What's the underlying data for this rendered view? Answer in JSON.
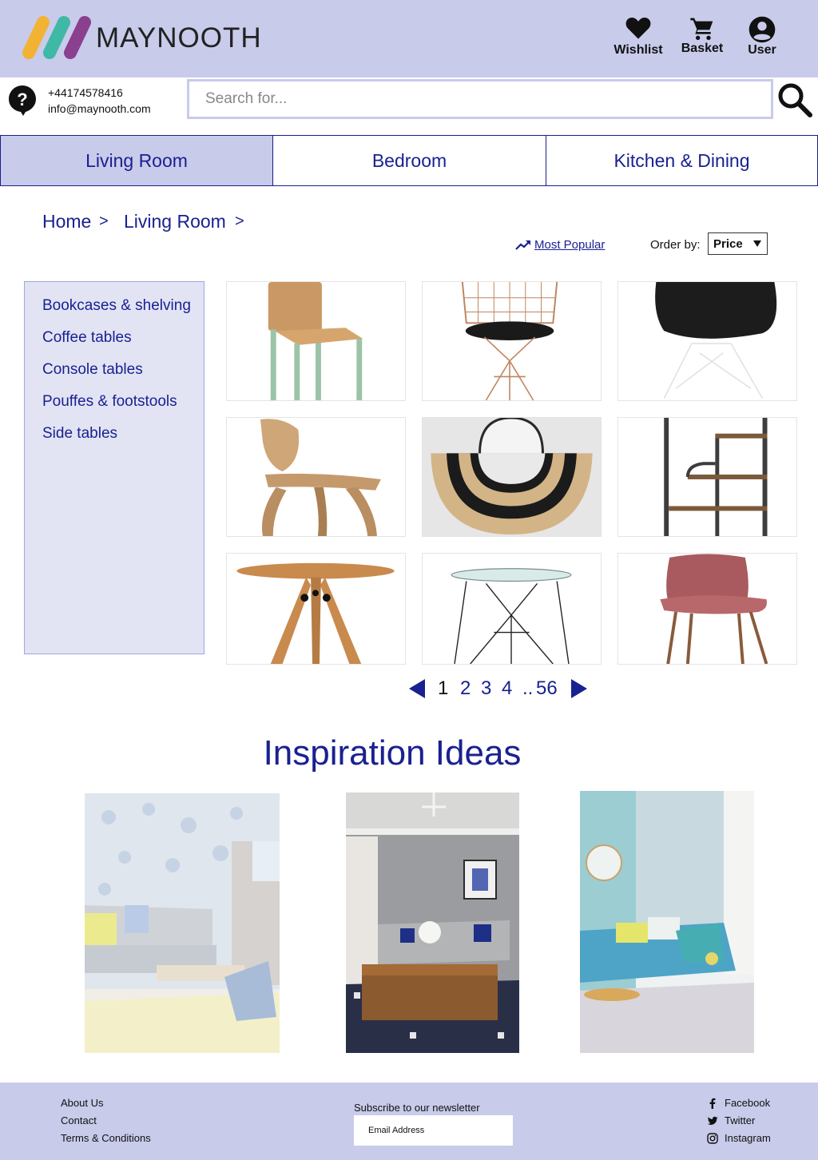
{
  "header": {
    "brand": "MAYNOOTH",
    "wishlist_label": "Wishlist",
    "basket_label": "Basket",
    "user_label": "User",
    "logo_colors": [
      "#f2b233",
      "#3fb8a6",
      "#8b3f8f"
    ]
  },
  "contact": {
    "phone": "+44174578416",
    "email": "info@maynooth.com"
  },
  "search": {
    "placeholder": "Search for..."
  },
  "tabs": [
    {
      "label": "Living Room",
      "active": true
    },
    {
      "label": "Bedroom",
      "active": false
    },
    {
      "label": "Kitchen & Dining",
      "active": false
    }
  ],
  "breadcrumb": {
    "items": [
      "Home",
      "Living Room"
    ],
    "separator": ">"
  },
  "sort": {
    "most_popular": "Most Popular",
    "order_label": "Order by:",
    "order_value": "Price"
  },
  "sidebar": {
    "categories": [
      "Bookcases & shelving",
      "Coffee tables",
      "Console tables",
      "Pouffes & footstools",
      "Side tables"
    ]
  },
  "products": [
    {
      "icon": "wooden-chair-green-legs"
    },
    {
      "icon": "copper-wire-chair"
    },
    {
      "icon": "black-shell-chair"
    },
    {
      "icon": "bent-plywood-chair"
    },
    {
      "icon": "fringe-mirror"
    },
    {
      "icon": "metal-wood-shelving"
    },
    {
      "icon": "round-wood-table"
    },
    {
      "icon": "glass-wire-table"
    },
    {
      "icon": "pink-velvet-chair"
    }
  ],
  "pagination": {
    "pages": [
      "1",
      "2",
      "3",
      "4"
    ],
    "ellipsis": "..",
    "last": "56",
    "current": "1"
  },
  "inspiration": {
    "title": "Inspiration Ideas"
  },
  "footer": {
    "links": [
      "About Us",
      "Contact",
      "Terms & Conditions"
    ],
    "newsletter_label": "Subscribe to our newsletter",
    "newsletter_placeholder": "Email Address",
    "social": [
      "Facebook",
      "Twitter",
      "Instagram"
    ]
  },
  "colors": {
    "header_bg": "#c8cbea",
    "accent": "#1a2190",
    "sidebar_bg": "#e2e4f4"
  }
}
